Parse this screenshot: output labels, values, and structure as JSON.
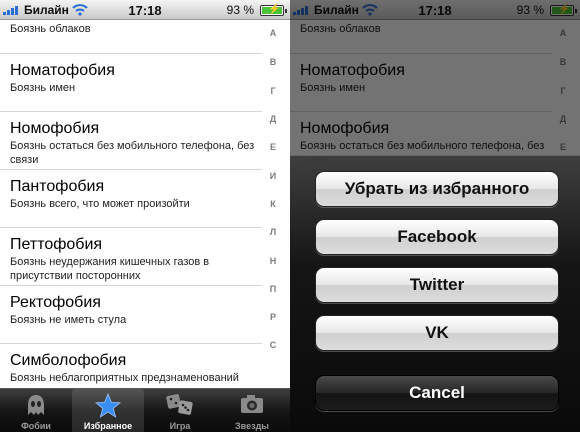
{
  "status": {
    "carrier": "Билайн",
    "time": "17:18",
    "battery": "93 %",
    "battery_level": 0.93
  },
  "list": [
    {
      "title": "",
      "sub": "Боязнь облаков"
    },
    {
      "title": "Номатофобия",
      "sub": "Боязнь имен"
    },
    {
      "title": "Номофобия",
      "sub": "Боязнь остаться без мобильного телефона, без связи"
    },
    {
      "title": "Пантофобия",
      "sub": "Боязнь всего, что может произойти"
    },
    {
      "title": "Петтофобия",
      "sub": "Боязнь неудержания кишечных газов в присутствии посторонних"
    },
    {
      "title": "Ректофобия",
      "sub": "Боязнь не иметь стула"
    },
    {
      "title": "Симболофобия",
      "sub": "Боязнь неблагоприятных предзнаменований"
    }
  ],
  "index": [
    "А",
    "В",
    "Г",
    "Д",
    "Е",
    "И",
    "К",
    "Л",
    "Н",
    "П",
    "Р",
    "С"
  ],
  "tabs": [
    {
      "label": "Фобии",
      "icon": "ghost-icon"
    },
    {
      "label": "Избранное",
      "icon": "star-icon",
      "active": true
    },
    {
      "label": "Игра",
      "icon": "dice-icon"
    },
    {
      "label": "Звезды",
      "icon": "camera-icon"
    }
  ],
  "action_sheet": {
    "remove_favorite": "Убрать из избранного",
    "facebook": "Facebook",
    "twitter": "Twitter",
    "vk": "VK",
    "cancel": "Cancel"
  }
}
